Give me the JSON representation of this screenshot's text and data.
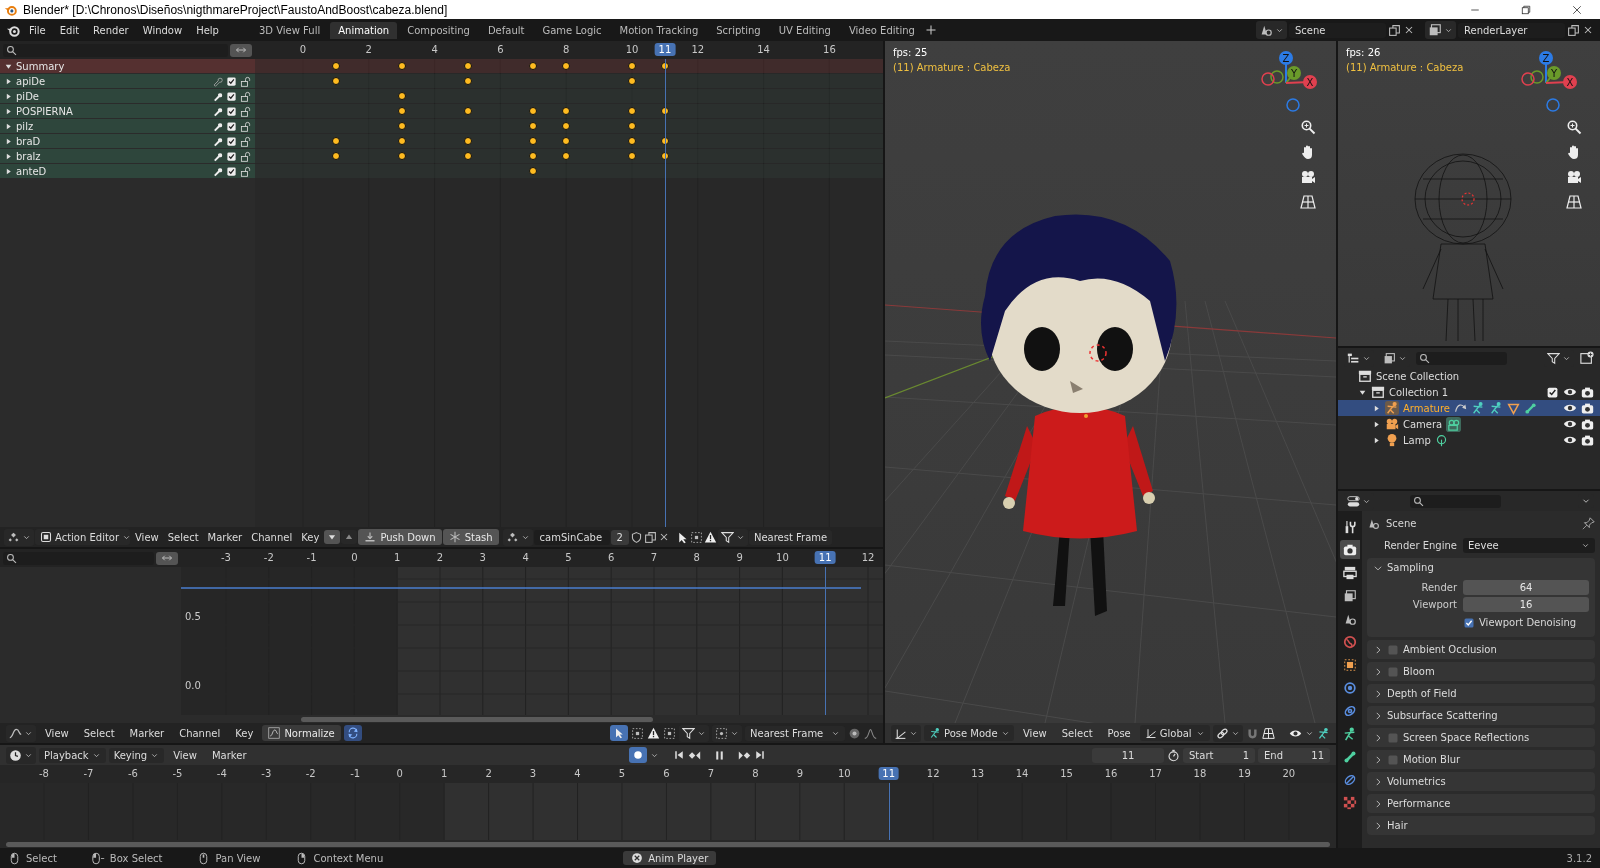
{
  "title_bar": {
    "title": "Blender* [D:\\Chronos\\Diseños\\nigthmareProject\\FaustoAndBoost\\cabeza.blend]"
  },
  "top_bar": {
    "menus": [
      "File",
      "Edit",
      "Render",
      "Window",
      "Help"
    ],
    "workspaces": [
      {
        "label": "3D View Full",
        "selected": false
      },
      {
        "label": "Animation",
        "selected": true
      },
      {
        "label": "Compositing",
        "selected": false
      },
      {
        "label": "Default",
        "selected": false
      },
      {
        "label": "Game Logic",
        "selected": false
      },
      {
        "label": "Motion Tracking",
        "selected": false
      },
      {
        "label": "Scripting",
        "selected": false
      },
      {
        "label": "UV Editing",
        "selected": false
      },
      {
        "label": "Video Editing",
        "selected": false
      }
    ],
    "scene": "Scene",
    "view_layer": "RenderLayer"
  },
  "dope_sheet": {
    "ruler": [
      "0",
      "2",
      "4",
      "6",
      "8",
      "10",
      "12",
      "14",
      "16"
    ],
    "current_frame": "11",
    "channels": [
      {
        "kind": "summary",
        "name": "Summary",
        "expanded": true,
        "keyframes": [
          false,
          true,
          false,
          true,
          false,
          true,
          false,
          true,
          true,
          false,
          true,
          true
        ]
      },
      {
        "kind": "channel",
        "name": "apiDe",
        "expanded": false,
        "modifiers": false,
        "checked": true,
        "locked": false,
        "keyframes": [
          false,
          true,
          false,
          false,
          false,
          true,
          false,
          false,
          false,
          false,
          true,
          false
        ]
      },
      {
        "kind": "channel",
        "name": "piDe",
        "expanded": false,
        "modifiers": true,
        "checked": true,
        "locked": false,
        "keyframes": [
          false,
          false,
          false,
          true,
          false,
          false,
          false,
          false,
          false,
          false,
          false,
          false
        ]
      },
      {
        "kind": "channel",
        "name": "POSPIERNA",
        "expanded": false,
        "modifiers": true,
        "checked": true,
        "locked": false,
        "keyframes": [
          false,
          false,
          false,
          true,
          false,
          true,
          false,
          true,
          true,
          false,
          true,
          true
        ]
      },
      {
        "kind": "channel",
        "name": "pilz",
        "expanded": false,
        "modifiers": true,
        "checked": true,
        "locked": false,
        "keyframes": [
          false,
          false,
          false,
          true,
          false,
          false,
          false,
          true,
          true,
          false,
          true,
          false
        ]
      },
      {
        "kind": "channel",
        "name": "braD",
        "expanded": false,
        "modifiers": true,
        "checked": true,
        "locked": false,
        "keyframes": [
          false,
          true,
          false,
          true,
          false,
          true,
          false,
          true,
          true,
          false,
          true,
          true
        ]
      },
      {
        "kind": "channel",
        "name": "bralz",
        "expanded": false,
        "modifiers": true,
        "checked": true,
        "locked": false,
        "keyframes": [
          false,
          true,
          false,
          true,
          false,
          true,
          false,
          true,
          true,
          false,
          true,
          true
        ]
      },
      {
        "kind": "channel",
        "name": "anteD",
        "expanded": false,
        "modifiers": true,
        "checked": true,
        "locked": false,
        "keyframes": [
          false,
          false,
          false,
          false,
          false,
          false,
          false,
          true,
          false,
          false,
          false,
          false
        ]
      }
    ]
  },
  "action_editor_header": {
    "mode": "Action Editor",
    "menus": [
      "View",
      "Select",
      "Marker",
      "Channel",
      "Key"
    ],
    "push_down": "Push Down",
    "stash": "Stash",
    "action": "camSinCabe",
    "users": "2",
    "snapping": "Nearest Frame"
  },
  "graph_editor": {
    "ruler": [
      "-3",
      "-2",
      "-1",
      "0",
      "1",
      "2",
      "3",
      "4",
      "5",
      "6",
      "7",
      "8",
      "9",
      "10",
      "12"
    ],
    "current_frame": "11",
    "y_labels": [
      "0.5",
      "0.0"
    ],
    "header": {
      "menus": [
        "View",
        "Select",
        "Marker",
        "Channel",
        "Key"
      ],
      "normalize": "Normalize",
      "snapping": "Nearest Frame"
    }
  },
  "viewport": {
    "fps": "fps: 25",
    "object": "(11) Armature : Cabeza",
    "gizmo": [
      {
        "label": "Z",
        "color": "#2c7be5"
      },
      {
        "label": "Y",
        "color": "#6a9a2a"
      },
      {
        "label": "X",
        "color": "#e0404f"
      }
    ],
    "header": {
      "mode": "Pose Mode",
      "menus": [
        "View",
        "Select",
        "Pose"
      ],
      "orientation": "Global"
    }
  },
  "viewport_2": {
    "fps": "fps: 26",
    "object": "(11) Armature : Cabeza",
    "gizmo": [
      {
        "label": "Z",
        "color": "#2c7be5"
      },
      {
        "label": "Y",
        "color": "#6a9a2a"
      },
      {
        "label": "X",
        "color": "#e0404f"
      }
    ]
  },
  "outliner": {
    "tree": [
      {
        "kind": "scene",
        "label": "Scene Collection",
        "children": [
          {
            "kind": "collection",
            "label": "Collection 1",
            "expanded": true,
            "checked": true,
            "children": [
              {
                "kind": "armature",
                "label": "Armature",
                "selected": true,
                "expanded": false
              },
              {
                "kind": "camera",
                "label": "Camera",
                "selected": false,
                "expanded": false
              },
              {
                "kind": "light",
                "label": "Lamp",
                "selected": false,
                "expanded": false
              }
            ]
          }
        ]
      }
    ]
  },
  "properties": {
    "tabs": [
      {
        "kind": "tool",
        "selected": false
      },
      {
        "kind": "render",
        "selected": true
      },
      {
        "kind": "output",
        "selected": false
      },
      {
        "kind": "view_layer",
        "selected": false
      },
      {
        "kind": "scene",
        "selected": false
      },
      {
        "kind": "world",
        "selected": false
      },
      {
        "kind": "object",
        "selected": false
      },
      {
        "kind": "physics",
        "selected": false
      },
      {
        "kind": "constraints",
        "selected": false
      },
      {
        "kind": "data",
        "selected": false
      },
      {
        "kind": "bone",
        "selected": false
      },
      {
        "kind": "bone_constraints",
        "selected": false
      },
      {
        "kind": "texture",
        "selected": false
      }
    ],
    "context": "Scene",
    "render_engine_label": "Render Engine",
    "render_engine": "Eevee",
    "panels": [
      {
        "kind": "plain",
        "label": "Sampling",
        "expanded": true,
        "fields": [
          {
            "label": "Render",
            "value": "64"
          },
          {
            "label": "Viewport",
            "value": "16"
          }
        ],
        "options": [
          {
            "label": "Viewport Denoising",
            "checked": true
          }
        ]
      },
      {
        "kind": "toggle",
        "label": "Ambient Occlusion",
        "expanded": false,
        "checked": false
      },
      {
        "kind": "toggle",
        "label": "Bloom",
        "expanded": false,
        "checked": false
      },
      {
        "kind": "plain",
        "label": "Depth of Field",
        "expanded": false
      },
      {
        "kind": "plain",
        "label": "Subsurface Scattering",
        "expanded": false
      },
      {
        "kind": "toggle",
        "label": "Screen Space Reflections",
        "expanded": false,
        "checked": false
      },
      {
        "kind": "toggle",
        "label": "Motion Blur",
        "expanded": false,
        "checked": false
      },
      {
        "kind": "plain",
        "label": "Volumetrics",
        "expanded": false
      },
      {
        "kind": "plain",
        "label": "Performance",
        "expanded": false
      },
      {
        "kind": "plain",
        "label": "Hair",
        "expanded": false
      }
    ]
  },
  "timeline": {
    "menus": [
      {
        "kind": "dropdown",
        "label": "Playback"
      },
      {
        "kind": "dropdown",
        "label": "Keying"
      },
      {
        "kind": "menu",
        "label": "View"
      },
      {
        "kind": "menu",
        "label": "Marker"
      }
    ],
    "current": "11",
    "start_label": "Start",
    "start": "1",
    "end_label": "End",
    "end": "11",
    "ruler": [
      "-8",
      "-7",
      "-6",
      "-5",
      "-4",
      "-3",
      "-2",
      "-1",
      "0",
      "1",
      "2",
      "3",
      "4",
      "5",
      "6",
      "7",
      "8",
      "9",
      "10",
      "12",
      "13",
      "14",
      "15",
      "16",
      "17",
      "18",
      "19",
      "20"
    ],
    "current_frame": "11"
  },
  "status_bar": {
    "hints": [
      {
        "kind": "left",
        "label": "Select"
      },
      {
        "kind": "drag",
        "label": "Box Select"
      },
      {
        "kind": "middle",
        "label": "Pan View"
      },
      {
        "kind": "right",
        "label": "Context Menu"
      }
    ],
    "job": "Anim Player",
    "version": "3.1.2"
  }
}
